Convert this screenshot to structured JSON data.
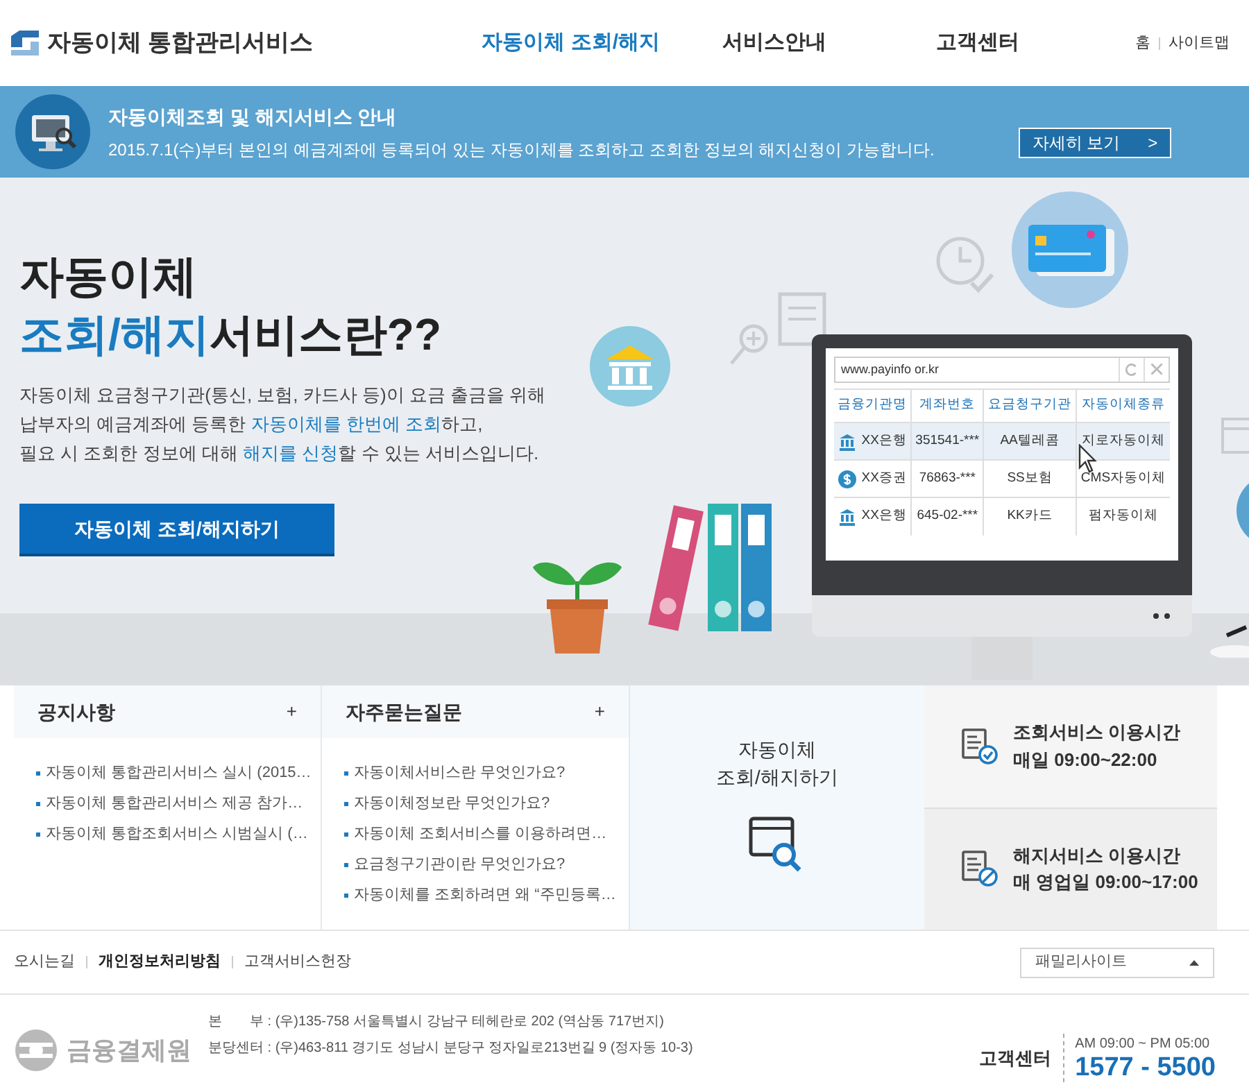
{
  "header": {
    "logo": "자동이체 통합관리서비스",
    "nav": [
      {
        "label": "자동이체 조회/해지",
        "selected": true
      },
      {
        "label": "서비스안내",
        "selected": false
      },
      {
        "label": "고객센터",
        "selected": false
      }
    ],
    "util_links": [
      "홈",
      "사이트맵"
    ]
  },
  "banner": {
    "title": "자동이체조회 및 해지서비스 안내",
    "text": "2015.7.1(수)부터 본인의 예금계좌에 등록되어 있는 자동이체를 조회하고 조회한 정보의 해지신청이 가능합니다.",
    "button": "자세히 보기",
    "button_arrow": ">"
  },
  "hero": {
    "title_line1": "자동이체",
    "title_highlight": "조회/해지",
    "title_rest": "서비스란??",
    "description": [
      {
        "text": "자동이체 요금청구기관(통신, 보험, 카드사 등)이 요금 출금을 위해 ",
        "highlight": false
      },
      {
        "text": "납부자의 예금계좌에 등록한 ",
        "highlight": false
      },
      {
        "text": "자동이체를 한번에 조회",
        "highlight": true
      },
      {
        "text": "하고, ",
        "highlight": false
      },
      {
        "text": "필요 시 조회한 정보에 대해 ",
        "highlight": false
      },
      {
        "text": "해지를 신청",
        "highlight": true
      },
      {
        "text": "할 수 있는 서비스입니다.",
        "highlight": false
      }
    ],
    "button": "자동이체 조회/해지하기",
    "monitor": {
      "url": "www.payinfo or.kr",
      "columns": [
        "금융기관명",
        "계좌번호",
        "요금청구기관",
        "자동이체종류"
      ],
      "rows": [
        {
          "kind": "bank",
          "selected": true,
          "cells": [
            "XX은행",
            "351541-***",
            "AA텔레콤",
            "지로자동이체"
          ]
        },
        {
          "kind": "coin",
          "selected": false,
          "cells": [
            "XX증권",
            "76863-***",
            "SS보험",
            "CMS자동이체"
          ]
        },
        {
          "kind": "bank",
          "selected": false,
          "cells": [
            "XX은행",
            "645-02-***",
            "KK카드",
            "펌자동이체"
          ]
        }
      ]
    }
  },
  "notice": {
    "title": "공지사항",
    "more": "+",
    "items": [
      "자동이체 통합관리서비스 실시 (2015…",
      "자동이체 통합관리서비스 제공 참가…",
      "자동이체 통합조회서비스 시범실시 (…"
    ]
  },
  "faq": {
    "title": "자주묻는질문",
    "more": "+",
    "items": [
      "자동이체서비스란 무엇인가요?",
      "자동이체정보란 무엇인가요?",
      "자동이체 조회서비스를 이용하려면…",
      "요금청구기관이란 무엇인가요?",
      "자동이체를 조회하려면 왜 “주민등록…"
    ]
  },
  "quick": {
    "line1": "자동이체",
    "line2": "조회/해지하기"
  },
  "hours": [
    {
      "kind": "check",
      "title": "조회서비스 이용시간",
      "time": "매일 09:00~22:00"
    },
    {
      "kind": "block",
      "title": "해지서비스 이용시간",
      "time": "매 영업일 09:00~17:00"
    }
  ],
  "footer": {
    "links": [
      {
        "label": "오시는길",
        "bold": false
      },
      {
        "label": "개인정보처리방침",
        "bold": true
      },
      {
        "label": "고객서비스헌장",
        "bold": false
      }
    ],
    "family_site": "패밀리사이트",
    "org": "금융결제원",
    "addresses": [
      "본　　부 : (우)135-758 서울특별시 강남구 테헤란로 202 (역삼동 717번지)",
      "분당센터 : (우)463-811 경기도 성남시 분당구 정자일로213번길 9 (정자동 10-3)"
    ],
    "center_label": "고객센터",
    "center_hours": "AM 09:00 ~ PM 05:00",
    "center_phone": "1577 - 5500"
  }
}
